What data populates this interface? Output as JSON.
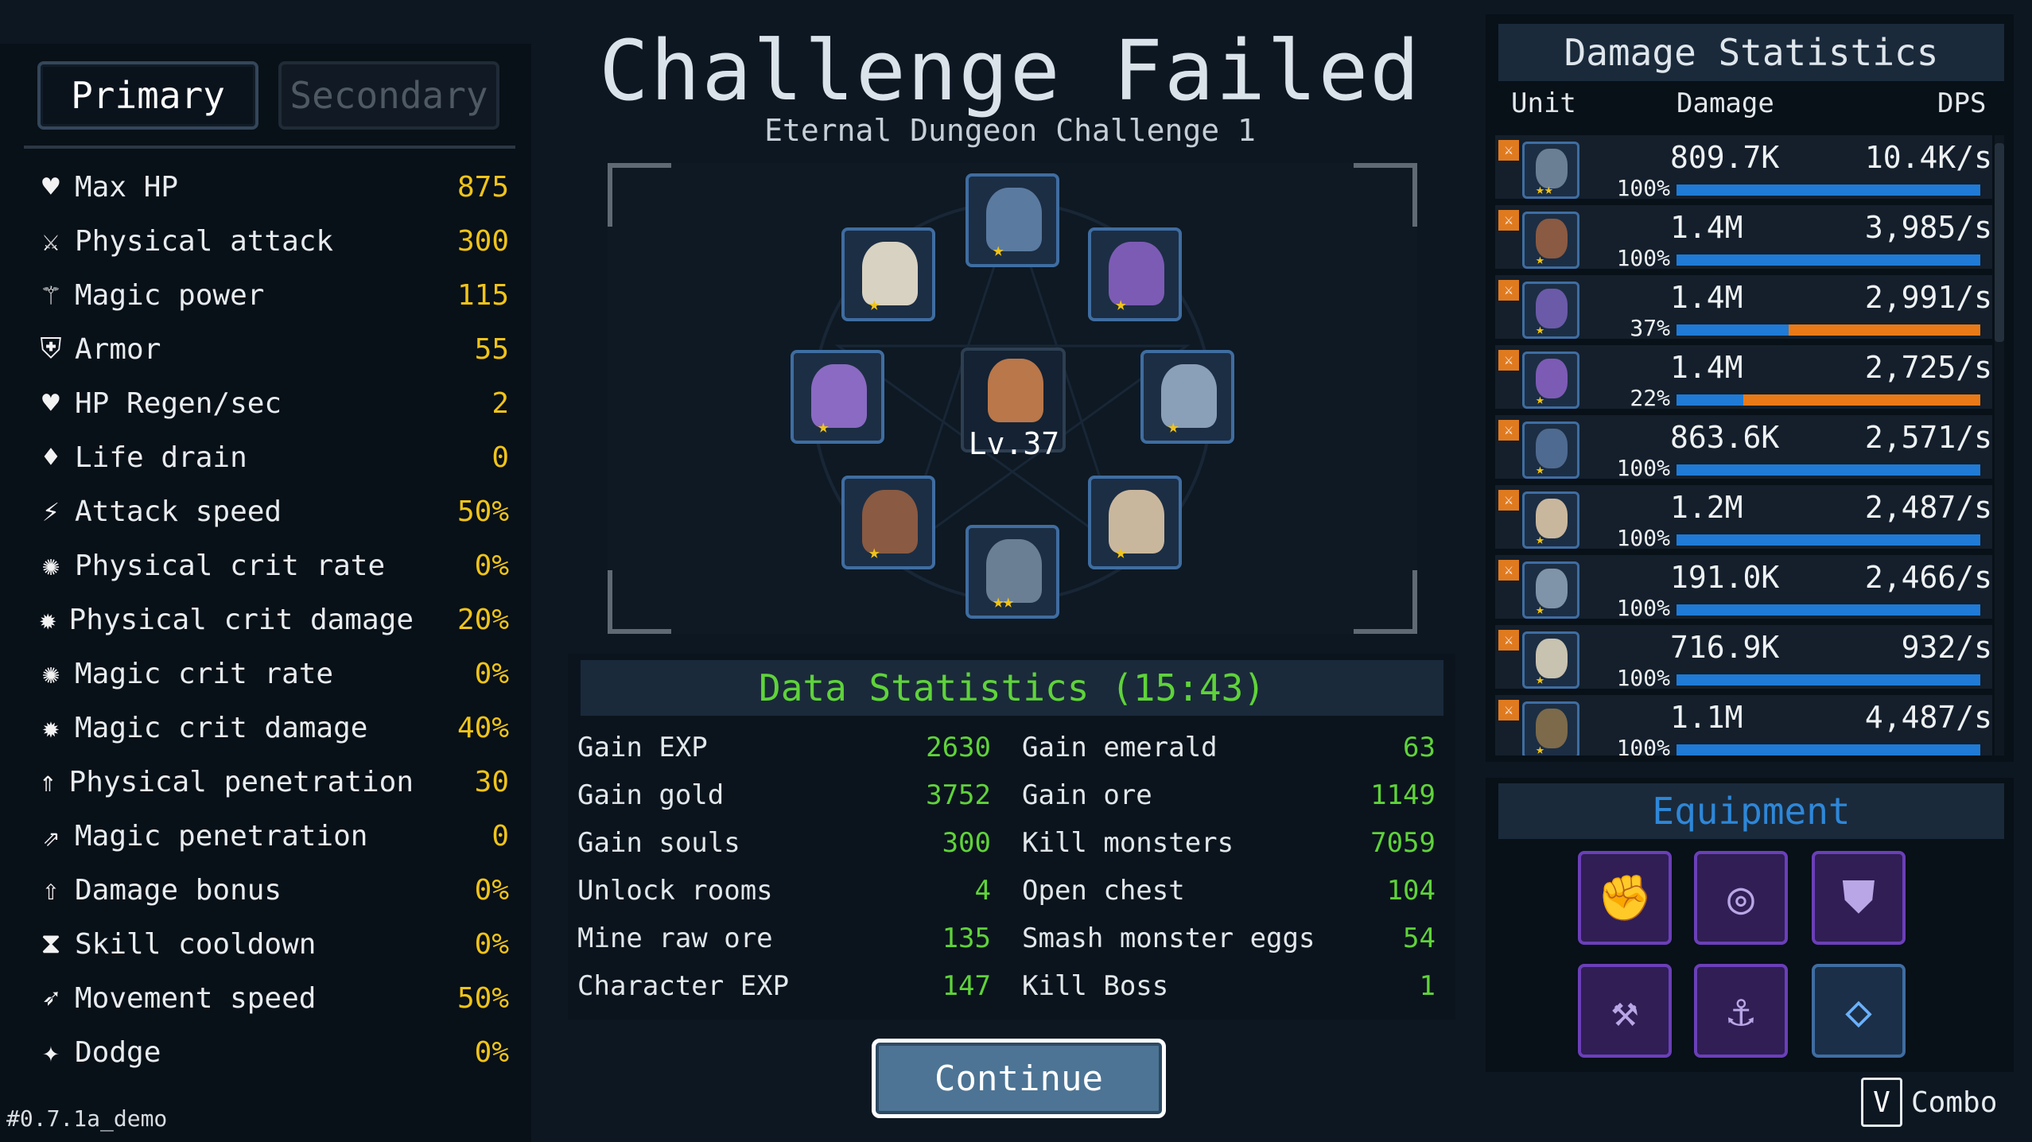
{
  "tabs": {
    "primary": "Primary",
    "secondary": "Secondary"
  },
  "stats": [
    {
      "icon": "heart-icon",
      "glyph": "♥",
      "label": "Max HP",
      "value": "875"
    },
    {
      "icon": "sword-icon",
      "glyph": "⚔",
      "label": "Physical attack",
      "value": "300"
    },
    {
      "icon": "wand-icon",
      "glyph": "⚚",
      "label": "Magic power",
      "value": "115"
    },
    {
      "icon": "shield-icon",
      "glyph": "⛨",
      "label": "Armor",
      "value": "55"
    },
    {
      "icon": "heart-regen-icon",
      "glyph": "♥",
      "label": "HP Regen/sec",
      "value": "2"
    },
    {
      "icon": "blood-drop-icon",
      "glyph": "♦",
      "label": "Life drain",
      "value": "0"
    },
    {
      "icon": "lightning-icon",
      "glyph": "⚡",
      "label": "Attack speed",
      "value": "50%"
    },
    {
      "icon": "physical-crit-icon",
      "glyph": "✺",
      "label": "Physical crit rate",
      "value": "0%"
    },
    {
      "icon": "physical-crit-damage-icon",
      "glyph": "✹",
      "label": "Physical crit damage",
      "value": "20%"
    },
    {
      "icon": "magic-crit-icon",
      "glyph": "✺",
      "label": "Magic crit rate",
      "value": "0%"
    },
    {
      "icon": "magic-crit-damage-icon",
      "glyph": "✹",
      "label": "Magic crit damage",
      "value": "40%"
    },
    {
      "icon": "physical-penetration-icon",
      "glyph": "⇑",
      "label": "Physical penetration",
      "value": "30"
    },
    {
      "icon": "magic-penetration-icon",
      "glyph": "⇗",
      "label": "Magic penetration",
      "value": "0"
    },
    {
      "icon": "damage-bonus-icon",
      "glyph": "⇧",
      "label": "Damage bonus",
      "value": "0%"
    },
    {
      "icon": "hourglass-icon",
      "glyph": "⧗",
      "label": "Skill cooldown",
      "value": "0%"
    },
    {
      "icon": "winged-boot-icon",
      "glyph": "➶",
      "label": "Movement speed",
      "value": "50%"
    },
    {
      "icon": "dodge-icon",
      "glyph": "✦",
      "label": "Dodge",
      "value": "0%"
    }
  ],
  "version": "#0.7.1a_demo",
  "header": {
    "title": "Challenge Failed",
    "subtitle": "Eternal Dungeon Challenge 1"
  },
  "center_hero": {
    "level": "Lv.37"
  },
  "data_statistics": {
    "title": "Data Statistics (15:43)",
    "left": [
      {
        "label": "Gain EXP",
        "value": "2630"
      },
      {
        "label": "Gain gold",
        "value": "3752"
      },
      {
        "label": "Gain souls",
        "value": "300"
      },
      {
        "label": "Unlock rooms",
        "value": "4"
      },
      {
        "label": "Mine raw ore",
        "value": "135"
      },
      {
        "label": "Character EXP",
        "value": "147"
      }
    ],
    "right": [
      {
        "label": "Gain emerald",
        "value": "63"
      },
      {
        "label": "Gain ore",
        "value": "1149"
      },
      {
        "label": "Kill monsters",
        "value": "7059"
      },
      {
        "label": "Open chest",
        "value": "104"
      },
      {
        "label": "Smash monster eggs",
        "value": "54"
      },
      {
        "label": "Kill Boss",
        "value": "1"
      }
    ]
  },
  "continue_label": "Continue",
  "damage_statistics": {
    "title": "Damage Statistics",
    "columns": {
      "unit": "Unit",
      "damage": "Damage",
      "dps": "DPS"
    },
    "rows": [
      {
        "damage": "809.7K",
        "dps": "10.4K/s",
        "pct": "100%",
        "fill": 1.0,
        "stars": "★★",
        "color": "#6a7f94"
      },
      {
        "damage": "1.4M",
        "dps": "3,985/s",
        "pct": "100%",
        "fill": 1.0,
        "stars": "★",
        "color": "#8a5a42"
      },
      {
        "damage": "1.4M",
        "dps": "2,991/s",
        "pct": "37%",
        "fill": 0.37,
        "stars": "★",
        "color": "#6b5aa8"
      },
      {
        "damage": "1.4M",
        "dps": "2,725/s",
        "pct": "22%",
        "fill": 0.22,
        "stars": "★",
        "color": "#7c5bb5"
      },
      {
        "damage": "863.6K",
        "dps": "2,571/s",
        "pct": "100%",
        "fill": 1.0,
        "stars": "★",
        "color": "#4f6a90"
      },
      {
        "damage": "1.2M",
        "dps": "2,487/s",
        "pct": "100%",
        "fill": 1.0,
        "stars": "★",
        "color": "#c9b79d"
      },
      {
        "damage": "191.0K",
        "dps": "2,466/s",
        "pct": "100%",
        "fill": 1.0,
        "stars": "★",
        "color": "#7f94a8"
      },
      {
        "damage": "716.9K",
        "dps": "932/s",
        "pct": "100%",
        "fill": 1.0,
        "stars": "★",
        "color": "#c8c2b0"
      },
      {
        "damage": "1.1M",
        "dps": "4,487/s",
        "pct": "100%",
        "fill": 1.0,
        "stars": "★",
        "color": "#7c6a4a"
      }
    ]
  },
  "equipment": {
    "title": "Equipment",
    "slots": [
      {
        "icon": "gauntlet-icon",
        "glyph": "✊",
        "variant": "purple"
      },
      {
        "icon": "necklace-icon",
        "glyph": "◎",
        "variant": "purple"
      },
      {
        "icon": "chest-armor-icon",
        "glyph": "⛊",
        "variant": "purple"
      },
      {
        "icon": "axe-icon",
        "glyph": "⚒",
        "variant": "purple"
      },
      {
        "icon": "boots-icon",
        "glyph": "⚓",
        "variant": "purple"
      },
      {
        "icon": "amulet-icon",
        "glyph": "◇",
        "variant": "blue"
      }
    ]
  },
  "combo": {
    "key": "V",
    "label": "Combo"
  },
  "heroes": [
    {
      "name": "hero-blue-reaper",
      "color": "#5a7aa0",
      "stars": "★"
    },
    {
      "name": "hero-white-haired-swordsman",
      "color": "#d8d2c2",
      "stars": "★"
    },
    {
      "name": "hero-purple-cat-mage",
      "color": "#7c5bb5",
      "stars": "★"
    },
    {
      "name": "hero-horned-archer",
      "color": "#8a6ac2",
      "stars": "★"
    },
    {
      "name": "hero-ice-knight",
      "color": "#8aa0b8",
      "stars": "★"
    },
    {
      "name": "hero-rifle-gunner",
      "color": "#8a5a42",
      "stars": "★"
    },
    {
      "name": "hero-cannon-soldier",
      "color": "#6a7f94",
      "stars": "★★"
    },
    {
      "name": "hero-glasses-scholar",
      "color": "#c9b79d",
      "stars": "★"
    }
  ]
}
